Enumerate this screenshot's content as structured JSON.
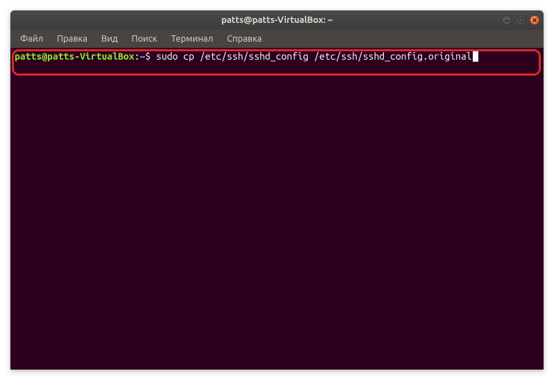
{
  "window": {
    "title": "patts@patts-VirtualBox: ~"
  },
  "menubar": {
    "items": [
      "Файл",
      "Правка",
      "Вид",
      "Поиск",
      "Терминал",
      "Справка"
    ]
  },
  "terminal": {
    "prompt_user": "patts@patts-VirtualBox",
    "prompt_colon": ":",
    "prompt_path": "~",
    "prompt_dollar": "$ ",
    "command": "sudo cp /etc/ssh/sshd_config /etc/ssh/sshd_config.original"
  }
}
